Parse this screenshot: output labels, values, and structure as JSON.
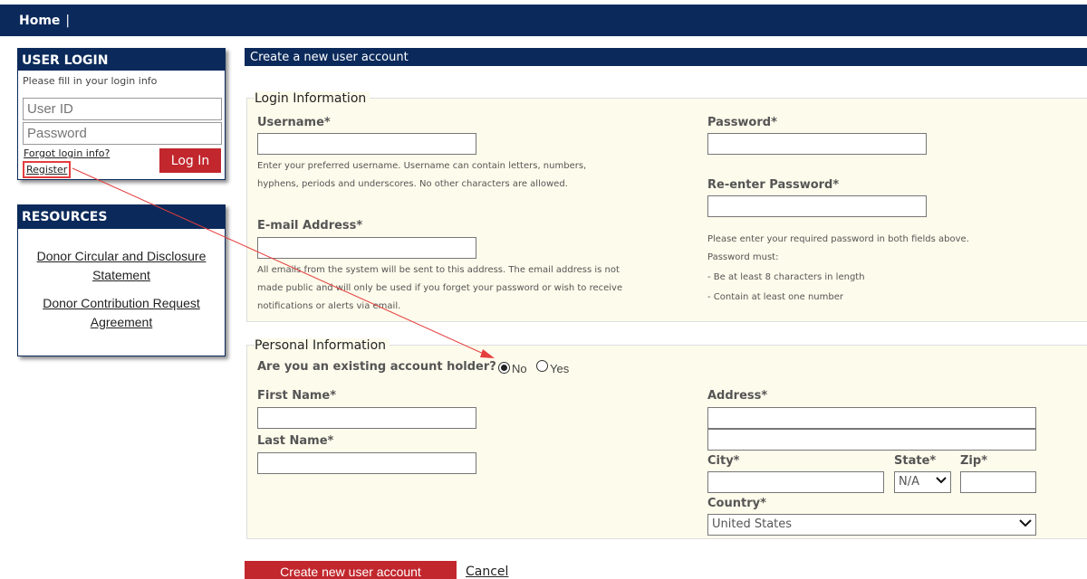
{
  "topbar": {
    "home_label": "Home",
    "separator": "|"
  },
  "login": {
    "title": "USER LOGIN",
    "hint": "Please fill in your login info",
    "user_placeholder": "User ID",
    "password_placeholder": "Password",
    "forgot": "Forgot login info?",
    "register": "Register",
    "button": "Log In"
  },
  "resources": {
    "title": "RESOURCES",
    "links": [
      {
        "line1": "Donor Circular and Disclosure",
        "line2": "Statement"
      },
      {
        "line1": "Donor Contribution Request",
        "line2": "Agreement"
      }
    ]
  },
  "main": {
    "title": "Create a new user account",
    "login_info": {
      "legend": "Login Information",
      "username_label": "Username*",
      "username_help_1": "Enter your preferred username. Username can contain letters, numbers,",
      "username_help_2": "hyphens, periods and underscores. No other characters are allowed.",
      "email_label": "E-mail Address*",
      "email_help_1": "All emails from the system will be sent to this address. The email address is not",
      "email_help_2": "made public and will only be used if you forget your password or wish to receive",
      "email_help_3": "notifications or alerts via email.",
      "password_label": "Password*",
      "reenter_label": "Re-enter Password*",
      "pw_help_1": "Please enter your required password in both fields above.",
      "pw_help_2": "Password must:",
      "pw_help_3": "- Be at least 8 characters in length",
      "pw_help_4": "- Contain at least one number"
    },
    "personal_info": {
      "legend": "Personal Information",
      "question": "Are you an existing account holder?",
      "opt_no": "No",
      "opt_yes": "Yes",
      "first_name_label": "First Name*",
      "last_name_label": "Last Name*",
      "address_label": "Address*",
      "city_label": "City*",
      "state_label": "State*",
      "zip_label": "Zip*",
      "state_value": "N/A",
      "country_label": "Country*",
      "country_value": "United States"
    },
    "submit": "Create new user account",
    "cancel": "Cancel"
  },
  "colors": {
    "navy": "#0b2a5b",
    "red_button": "#c1272d",
    "annotation_red": "#e53d3d",
    "form_bg": "#fdfbeb"
  }
}
